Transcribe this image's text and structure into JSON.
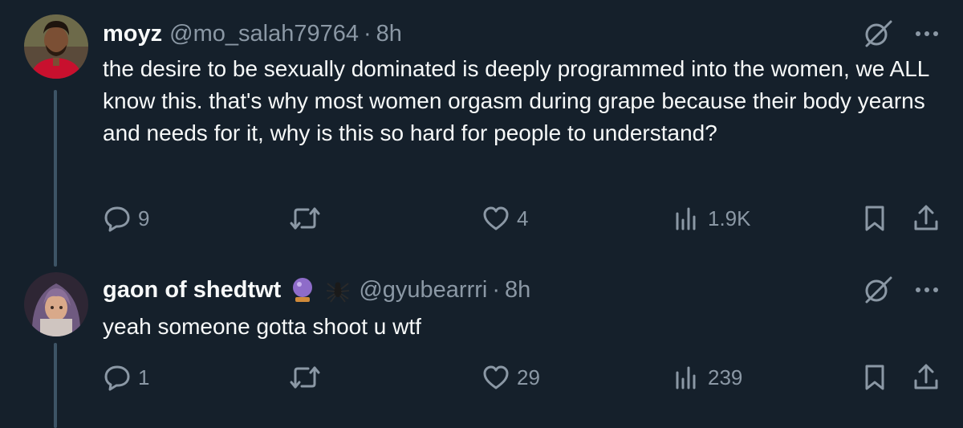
{
  "tweets": [
    {
      "display_name": "moyz",
      "handle": "@mo_salah79764",
      "separator": "·",
      "time": "8h",
      "text": "the desire to be sexually dominated is deeply programmed into the women, we ALL know this. that's why most women orgasm during grape because their body yearns and needs for it, why is this so hard for people to understand?",
      "replies": "9",
      "retweets": "",
      "likes": "4",
      "views": "1.9K",
      "avatar_colors": {
        "bg": "#7a1a22",
        "accent": "#c8102e"
      }
    },
    {
      "display_name": "gaon of shedtwt",
      "name_emojis": [
        "crystal-ball-icon",
        "spider-icon"
      ],
      "handle": "@gyubearrri",
      "separator": "·",
      "time": "8h",
      "text": "yeah someone gotta shoot u wtf",
      "replies": "1",
      "retweets": "",
      "likes": "29",
      "views": "239",
      "avatar_colors": {
        "bg": "#3a3040",
        "accent": "#8a6f98"
      }
    }
  ],
  "colors": {
    "background": "#15202b",
    "text_primary": "#f7f9f9",
    "text_secondary": "#8b98a5",
    "thread_line": "#3d5466"
  }
}
